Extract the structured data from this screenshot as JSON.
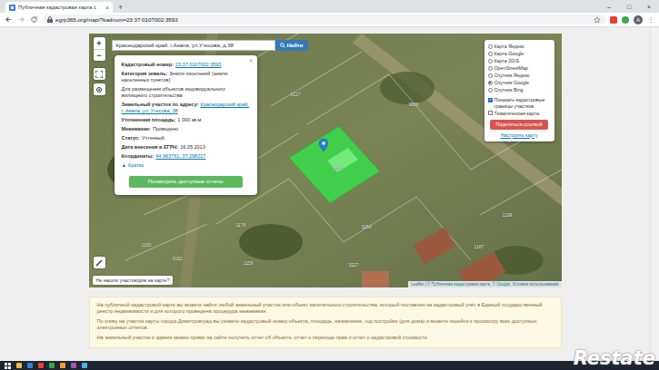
{
  "browser": {
    "tabs": [
      {
        "title": "Публичная кадастровая карта с",
        "close": "×",
        "selected": true
      }
    ],
    "new_tab": "+",
    "window_controls": [
      "–",
      "□",
      "×"
    ],
    "url": "egrp365.org/map/?kadnum=23:37:0107002:3593",
    "profile": "А",
    "menu": "⋮"
  },
  "map": {
    "search": {
      "value": "Краснодарский край, г.Анапа, ул.Утесова, д.38",
      "button": "Найти"
    },
    "zoom": [
      "+",
      "−"
    ],
    "popup": {
      "close": "×",
      "fields": [
        {
          "kind": "link",
          "label": "Кадастровый номер:",
          "value": "23:37:0107002:3593"
        },
        {
          "kind": "text",
          "label": "Категория земель:",
          "value": "Земли поселений (земли населенных пунктов)"
        },
        {
          "kind": "note",
          "value": "Для размещения объектов индивидуального жилищного строительства"
        },
        {
          "kind": "link",
          "label": "Земельный участок по адресу:",
          "value": "Краснодарский край, г. Анапа, ул. Утесова, 38"
        },
        {
          "kind": "text",
          "label": "Уточненная площадь:",
          "value": "1 000 кв.м"
        },
        {
          "kind": "text",
          "label": "Межевание:",
          "value": "Проведено"
        },
        {
          "kind": "text",
          "label": "Статус:",
          "value": "Учтенный"
        },
        {
          "kind": "text",
          "label": "Дата внесения в ЕГРН:",
          "value": "16.05.2013"
        },
        {
          "kind": "link",
          "label": "Координаты:",
          "value": "44.963761, 37.298227"
        }
      ],
      "collapse": {
        "icon": "▲",
        "label": "Кратко"
      },
      "button": "Посмотреть доступные отчеты"
    },
    "layers": {
      "options": [
        {
          "label": "Карта Яндекс",
          "selected": false
        },
        {
          "label": "Карта Google",
          "selected": false
        },
        {
          "label": "Карта 2GIS",
          "selected": false
        },
        {
          "label": "OpenStreetMap",
          "selected": false
        },
        {
          "label": "Спутник Яндекс",
          "selected": false
        },
        {
          "label": "Спутник Google",
          "selected": true
        },
        {
          "label": "Спутник Bing",
          "selected": false
        }
      ],
      "checks": [
        {
          "label": "Показать кадастровые границы участков",
          "checked": true
        },
        {
          "label": "Тематическая карта",
          "checked": false
        }
      ],
      "share": "Поделиться ссылкой",
      "settings": "Настроить карту"
    },
    "labels": [
      "8127",
      "9866",
      "1150",
      "1176",
      "3162",
      "1159",
      "3269",
      "3227",
      "1167",
      "1199",
      "3593"
    ],
    "not_found": "Не нашли участок/дом на карте?",
    "attribution": "Leaflet | © Публичная кадастровая карта, © Google, Условия использования"
  },
  "info": {
    "paragraphs": [
      "На публичной кадастровой карте вы можете найти любой земельный участок или объект капитального строительства, который поставлен на кадастровый учёт в Единый государственный реестр недвижимости и для которого проведена процедура межевания.",
      "По клику на участок карты города Димитровград вы узнаете кадастровый номер объекта, площадь, назначение, год постройки (для дома) и можете перейти к просмотру всех доступных электронных отчетов.",
      "На земельный участок и здание можно прямо на сайте получить отчет об объекте, отчет о переходе прав и отчет о кадастровой стоимости."
    ]
  },
  "watermark": "Restate"
}
